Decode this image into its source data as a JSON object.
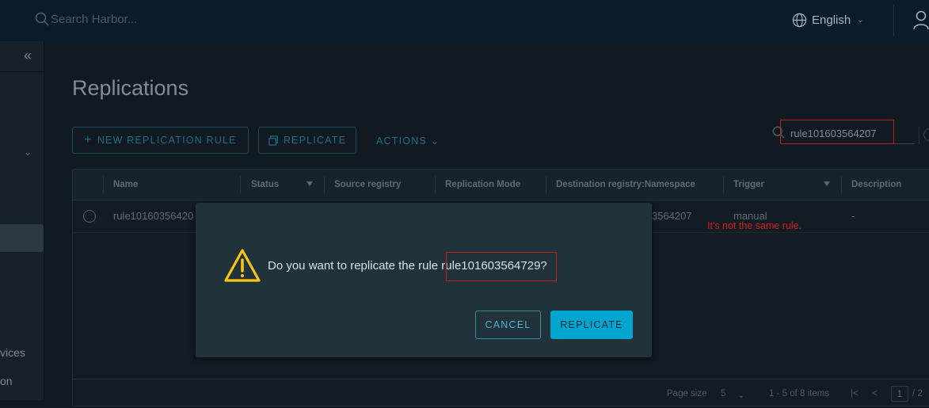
{
  "header": {
    "search_placeholder": "Search Harbor...",
    "language": "English"
  },
  "sidebar": {
    "partial_item_1": "vices",
    "partial_item_2": "on"
  },
  "page": {
    "title": "Replications",
    "new_rule_label": "NEW REPLICATION RULE",
    "replicate_label": "REPLICATE",
    "actions_label": "ACTIONS",
    "filter_value": "rule101603564207"
  },
  "table": {
    "columns": [
      "Name",
      "Status",
      "Source registry",
      "Replication Mode",
      "Destination registry:Namespace",
      "Trigger",
      "Description"
    ],
    "rows": [
      {
        "name": "rule10160356420",
        "destination": "3564207",
        "trigger": "manual",
        "description": "-"
      }
    ],
    "footer": {
      "page_size_label": "Page size",
      "page_size": "5",
      "items_info": "1 - 5 of 8 items",
      "current_page": "1",
      "total_pages": "/ 2"
    }
  },
  "annotation": "It's not the same rule.",
  "modal": {
    "message_prefix": "Do you want to replicate the rule ",
    "rule_name": "rule101603564729?",
    "cancel_label": "CANCEL",
    "confirm_label": "REPLICATE"
  },
  "colors": {
    "accent": "#00a6cf",
    "annotation_red": "#d41f1f",
    "warning_yellow": "#f5c518"
  },
  "icons": [
    "search-icon",
    "globe-icon",
    "chevron-down-icon",
    "user-icon",
    "collapse-icon",
    "plus-icon",
    "replicate-icon",
    "filter-icon",
    "refresh-icon",
    "warning-icon"
  ]
}
